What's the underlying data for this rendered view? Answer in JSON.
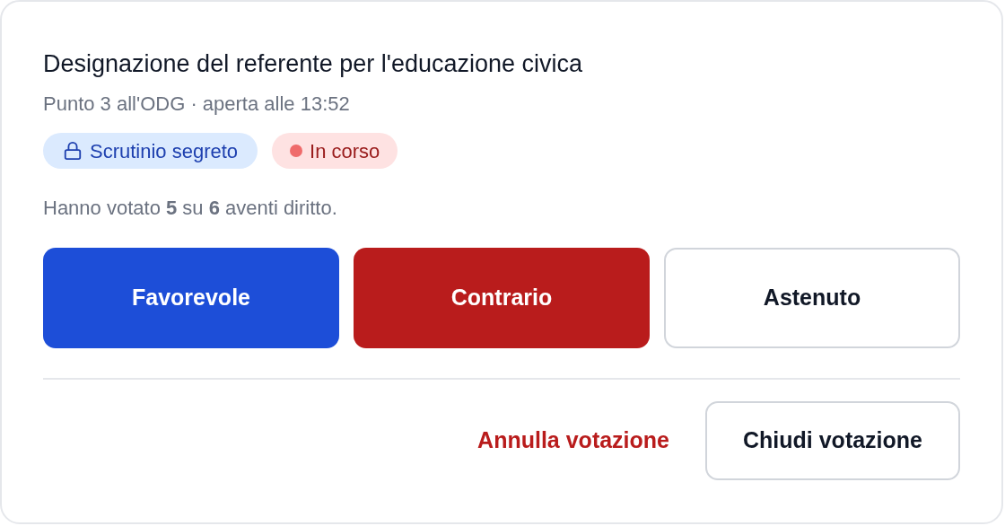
{
  "title": "Designazione del referente per l'educazione civica",
  "subtitle": "Punto 3 all'ODG · aperta alle 13:52",
  "badges": [
    {
      "kind": "secret",
      "label": "Scrutinio segreto"
    },
    {
      "kind": "live",
      "label": "In corso"
    }
  ],
  "turnout": "Hanno votato **5** su **6** aventi diritto.",
  "vote_buttons": [
    {
      "kind": "favor",
      "label": "Favorevole"
    },
    {
      "kind": "against",
      "label": "Contrario"
    },
    {
      "kind": "abstain",
      "label": "Astenuto"
    }
  ],
  "footer_buttons": [
    {
      "kind": "link",
      "label": "Annulla votazione"
    },
    {
      "kind": "outline",
      "label": "Chiudi votazione"
    }
  ]
}
